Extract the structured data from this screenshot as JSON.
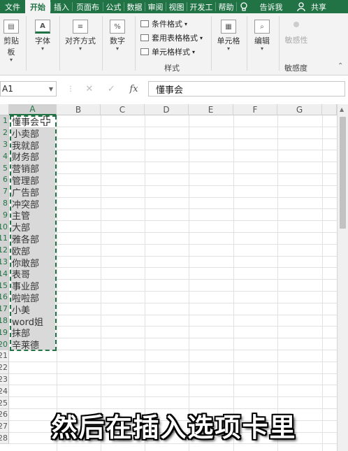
{
  "tabs": [
    "文件",
    "开始",
    "插入",
    "页面布",
    "公式",
    "数据",
    "审阅",
    "视图",
    "开发工",
    "帮助",
    "告诉我",
    "共享"
  ],
  "ribbon": {
    "clipboard": "剪贴板",
    "font": "字体",
    "align": "对齐方式",
    "number": "数字",
    "styles": {
      "conditional": "条件格式",
      "table": "套用表格格式",
      "cell_style": "单元格样式",
      "group_label": "样式"
    },
    "cells": "单元格",
    "edit": "编辑",
    "sensitivity_btn": "敏感性",
    "sensitivity_label": "敏感度"
  },
  "formula_bar": {
    "namebox": "A1",
    "value": "懂事会"
  },
  "columns": [
    "A",
    "B",
    "C",
    "D",
    "E",
    "F",
    "G"
  ],
  "rows": [
    "1",
    "2",
    "3",
    "4",
    "5",
    "6",
    "7",
    "8",
    "9",
    "10",
    "11",
    "12",
    "13",
    "14",
    "15",
    "16",
    "17",
    "18",
    "19",
    "20",
    "21",
    "22",
    "23",
    "24",
    "25",
    "26",
    "27",
    "28"
  ],
  "cells_a": [
    "懂事会",
    "小卖部",
    "我就部",
    "财务部",
    "营销部",
    "管理部",
    "广告部",
    "冲突部",
    "主管",
    "大部",
    "雅各部",
    "欧部",
    "你敢部",
    "表哥",
    "事业部",
    "啦啦部",
    "小美",
    "word姐",
    "抹部",
    "辛莱德"
  ],
  "subtitle": "然后在插入选项卡里",
  "colors": {
    "accent": "#217346",
    "selection": "#d9d9d9"
  }
}
